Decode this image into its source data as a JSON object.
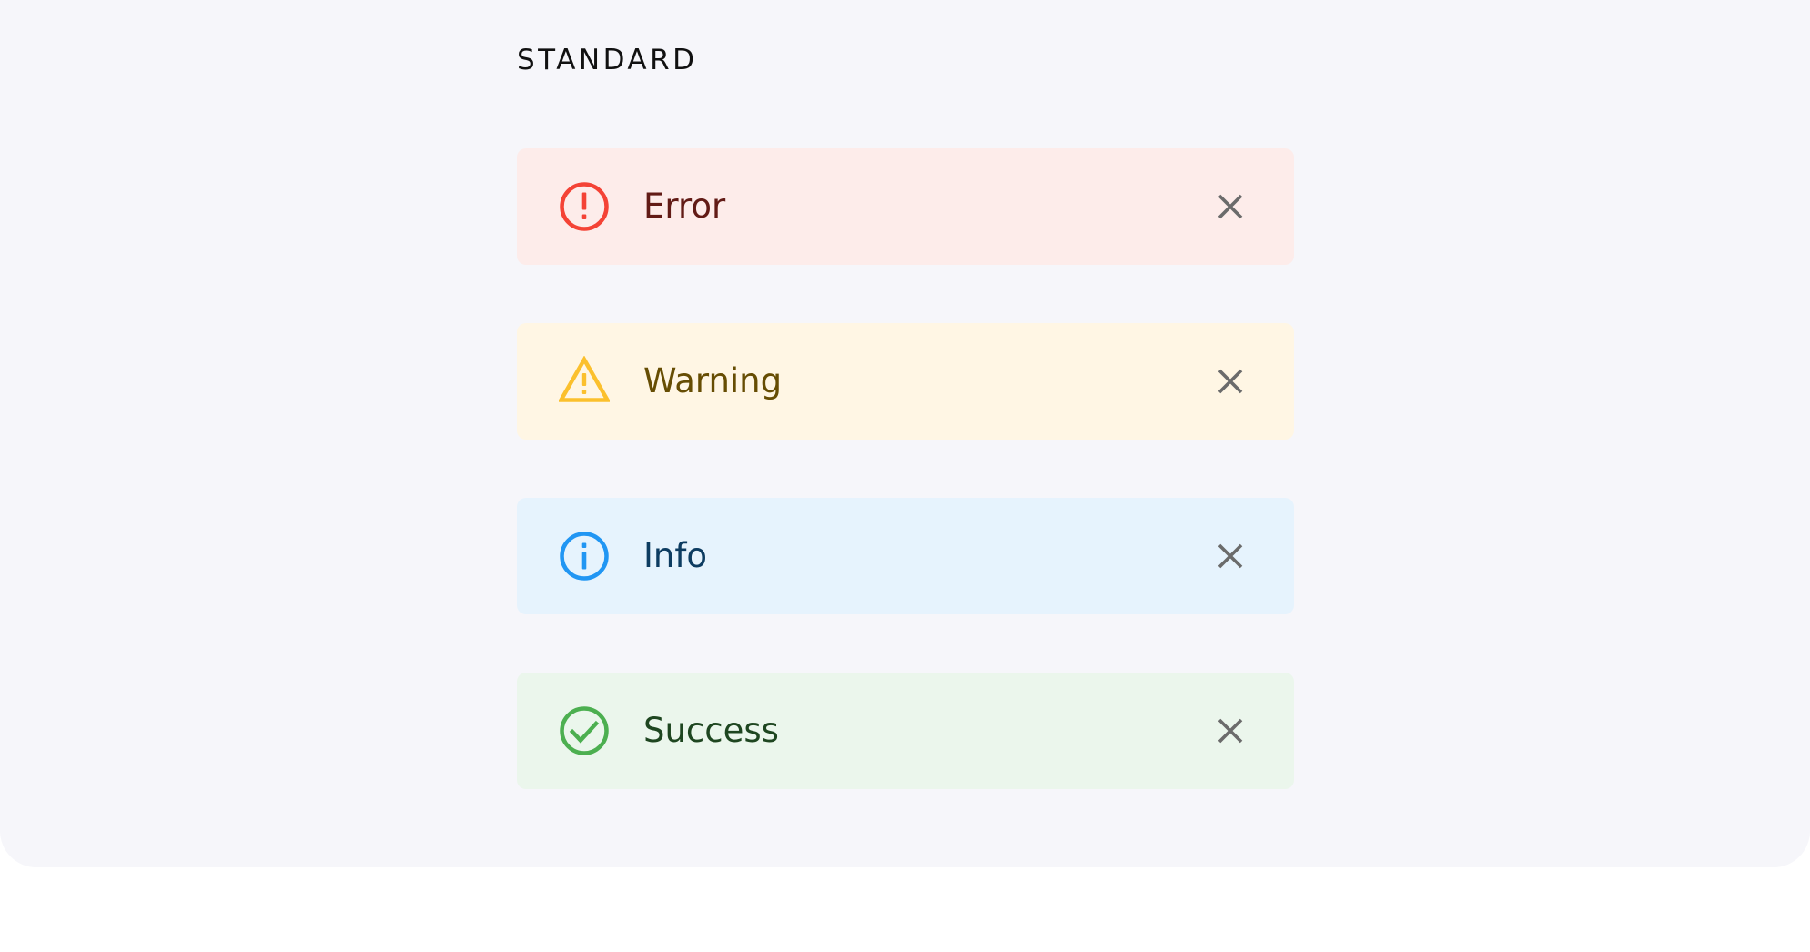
{
  "section": {
    "title": "STANDARD"
  },
  "alerts": [
    {
      "kind": "error",
      "label": "Error",
      "icon": "error-circle-icon",
      "bg": "#fdecea",
      "accent": "#f44336",
      "text_color": "#621b16"
    },
    {
      "kind": "warning",
      "label": "Warning",
      "icon": "warning-triangle-icon",
      "bg": "#fff6e4",
      "accent": "#fbc02d",
      "text_color": "#664d03"
    },
    {
      "kind": "info",
      "label": "Info",
      "icon": "info-circle-icon",
      "bg": "#e6f3fd",
      "accent": "#2196f3",
      "text_color": "#0d3c61"
    },
    {
      "kind": "success",
      "label": "Success",
      "icon": "check-circle-icon",
      "bg": "#ebf6ec",
      "accent": "#4caf50",
      "text_color": "#1e4620"
    }
  ],
  "close_icon": {
    "name": "close-icon",
    "color": "#6b6b6b"
  }
}
